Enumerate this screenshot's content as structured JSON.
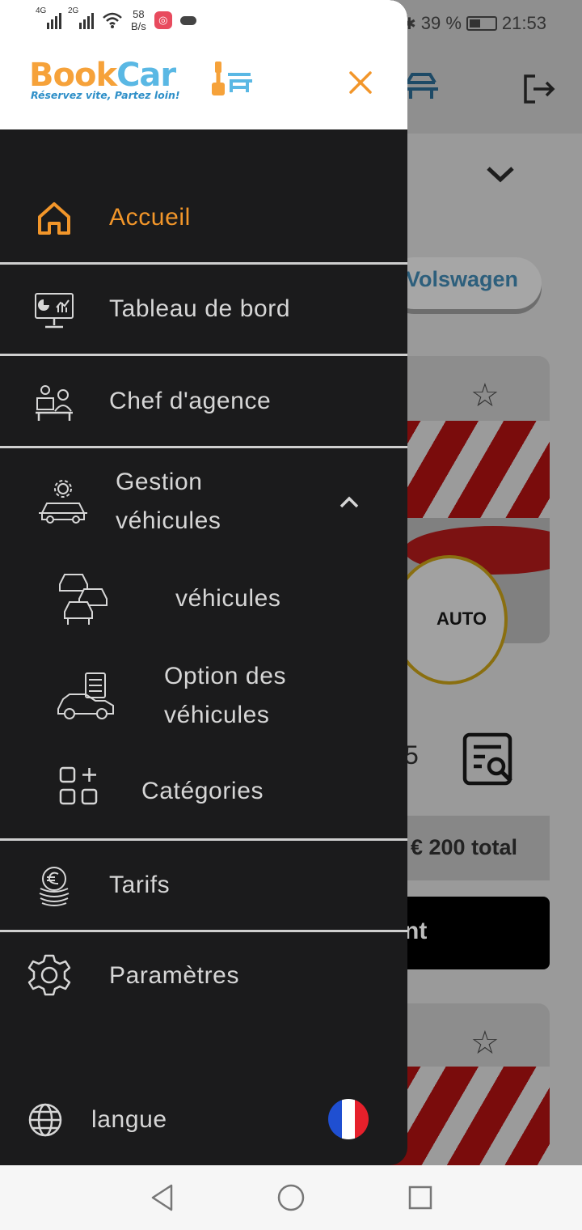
{
  "status_bar": {
    "network_1": "4G",
    "network_2": "2G",
    "speed_value": "58",
    "speed_unit": "B/s",
    "battery": "39 %",
    "time": "21:53"
  },
  "logo": {
    "name_part1": "Book",
    "name_part2": "Car",
    "tagline": "Réservez vite, Partez loin!"
  },
  "menu": {
    "home": "Accueil",
    "dashboard": "Tableau de bord",
    "agency_manager": "Chef d'agence",
    "vehicle_management_line1": "Gestion",
    "vehicle_management_line2": "véhicules",
    "vehicles": "véhicules",
    "vehicle_options_line1": "Option des",
    "vehicle_options_line2": "véhicules",
    "categories": "Catégories",
    "rates": "Tarifs",
    "settings": "Paramètres",
    "language": "langue"
  },
  "background": {
    "brand_chip": "Volswagen",
    "agency_logo_text": "AUTO",
    "seats": "5",
    "price": "€ 200 total",
    "rent_button": "nt"
  },
  "colors": {
    "accent": "#f2962a",
    "drawer_bg": "#1b1b1c",
    "logo_orange": "#f6a23a",
    "logo_blue": "#5ab8e4"
  },
  "icons": {
    "close": "close-icon",
    "home": "home-icon",
    "dashboard": "dashboard-monitor-icon",
    "agency_manager": "manager-desk-icon",
    "vehicle_management": "car-gear-icon",
    "vehicles": "cars-icon",
    "vehicle_options": "car-checklist-icon",
    "categories": "grid-plus-icon",
    "rates": "euro-coins-icon",
    "settings": "gear-icon",
    "language": "globe-icon",
    "flag": "france-flag-icon"
  }
}
